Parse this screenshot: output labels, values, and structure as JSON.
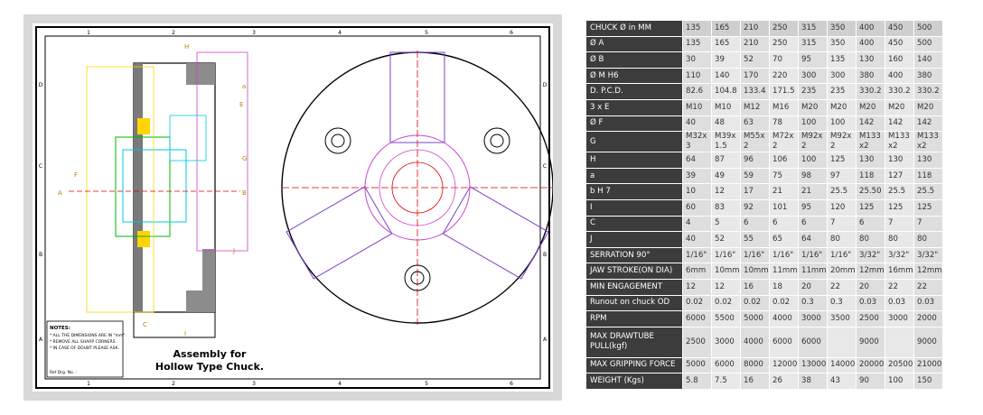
{
  "drawing": {
    "title_line1": "Assembly for",
    "title_line2": "Hollow Type Chuck.",
    "grid_cols": [
      "1",
      "2",
      "3",
      "4",
      "5",
      "6"
    ],
    "grid_rows": [
      "D",
      "C",
      "B",
      "A"
    ],
    "notes_heading": "NOTES:",
    "notes": [
      "* ALL THE DIMENSIONS ARE IN \"mm\".",
      "* REMOVE ALL SHARP CORNERS.",
      "* IN CASE OF DOUBT PLEASE ASK."
    ],
    "ref_label": "Ref Drg. No. :",
    "dim_labels": [
      "H",
      "E",
      "C",
      "I",
      "a",
      "J",
      "G",
      "B",
      "A",
      "F"
    ],
    "colors": {
      "outline": "#000000",
      "section": "#333333",
      "yellow": "#ffd400",
      "cyan": "#00c8e0",
      "green": "#00b400",
      "magenta": "#cc44cc",
      "red": "#e00000",
      "violet": "#7a40c8"
    }
  },
  "table": {
    "rows": [
      {
        "label": "CHUCK Ø in MM",
        "values": [
          "135",
          "165",
          "210",
          "250",
          "315",
          "350",
          "400",
          "450",
          "500"
        ]
      },
      {
        "label": "Ø A",
        "values": [
          "135",
          "165",
          "210",
          "250",
          "315",
          "350",
          "400",
          "450",
          "500"
        ]
      },
      {
        "label": "Ø B",
        "values": [
          "30",
          "39",
          "52",
          "70",
          "95",
          "135",
          "130",
          "160",
          "140"
        ]
      },
      {
        "label": "Ø M H6",
        "values": [
          "110",
          "140",
          "170",
          "220",
          "300",
          "300",
          "380",
          "400",
          "380"
        ]
      },
      {
        "label": "D. P.C.D.",
        "values": [
          "82.6",
          "104.8",
          "133.4",
          "171.5",
          "235",
          "235",
          "330.2",
          "330.2",
          "330.2"
        ]
      },
      {
        "label": "3 x E",
        "values": [
          "M10",
          "M10",
          "M12",
          "M16",
          "M20",
          "M20",
          "M20",
          "M20",
          "M20"
        ]
      },
      {
        "label": "Ø F",
        "values": [
          "40",
          "48",
          "63",
          "78",
          "100",
          "100",
          "142",
          "142",
          "142"
        ]
      },
      {
        "label": "G",
        "values": [
          "M32x3",
          "M39x1.5",
          "M55x2",
          "M72x2",
          "M92x2",
          "M92x2",
          "M133x2",
          "M133x2",
          "M133x2"
        ]
      },
      {
        "label": "H",
        "values": [
          "64",
          "87",
          "96",
          "106",
          "100",
          "125",
          "130",
          "130",
          "130"
        ]
      },
      {
        "label": "a",
        "values": [
          "39",
          "49",
          "59",
          "75",
          "98",
          "97",
          "118",
          "127",
          "118"
        ]
      },
      {
        "label": "b H 7",
        "values": [
          "10",
          "12",
          "17",
          "21",
          "21",
          "25.5",
          "25.50",
          "25.5",
          "25.5"
        ]
      },
      {
        "label": "I",
        "values": [
          "60",
          "83",
          "92",
          "101",
          "95",
          "120",
          "125",
          "125",
          "125"
        ]
      },
      {
        "label": "C",
        "values": [
          "4",
          "5",
          "6",
          "6",
          "6",
          "7",
          "6",
          "7",
          "7"
        ]
      },
      {
        "label": "J",
        "values": [
          "40",
          "52",
          "55",
          "65",
          "64",
          "80",
          "80",
          "80",
          "80"
        ]
      },
      {
        "label": "SERRATION 90°",
        "values": [
          "1/16\"",
          "1/16\"",
          "1/16\"",
          "1/16\"",
          "1/16\"",
          "1/16\"",
          "3/32\"",
          "3/32\"",
          "3/32\""
        ]
      },
      {
        "label": "JAW STROKE(ON DIA)",
        "values": [
          "6mm",
          "10mm",
          "10mm",
          "11mm",
          "11mm",
          "20mm",
          "12mm",
          "16mm",
          "12mm"
        ]
      },
      {
        "label": "MIN ENGAGEMENT",
        "values": [
          "12",
          "12",
          "16",
          "18",
          "20",
          "22",
          "20",
          "22",
          "22"
        ]
      },
      {
        "label": "Runout on chuck OD",
        "values": [
          "0.02",
          "0.02",
          "0.02",
          "0.02",
          "0.3",
          "0.3",
          "0.03",
          "0.03",
          "0.03"
        ]
      },
      {
        "label": "RPM",
        "values": [
          "6000",
          "5500",
          "5000",
          "4000",
          "3000",
          "3500",
          "2500",
          "3000",
          "2000"
        ]
      },
      {
        "label": "MAX DRAWTUBE PULL(kgf)",
        "values": [
          "2500",
          "3000",
          "4000",
          "6000",
          "6000",
          "",
          "9000",
          "",
          "9000"
        ]
      },
      {
        "label": "MAX GRIPPING FORCE",
        "values": [
          "5000",
          "6000",
          "8000",
          "12000",
          "13000",
          "14000",
          "20000",
          "20500",
          "21000"
        ]
      },
      {
        "label": "WEIGHT (Kgs)",
        "values": [
          "5.8",
          "7.5",
          "16",
          "26",
          "38",
          "43",
          "90",
          "100",
          "150"
        ]
      }
    ]
  }
}
